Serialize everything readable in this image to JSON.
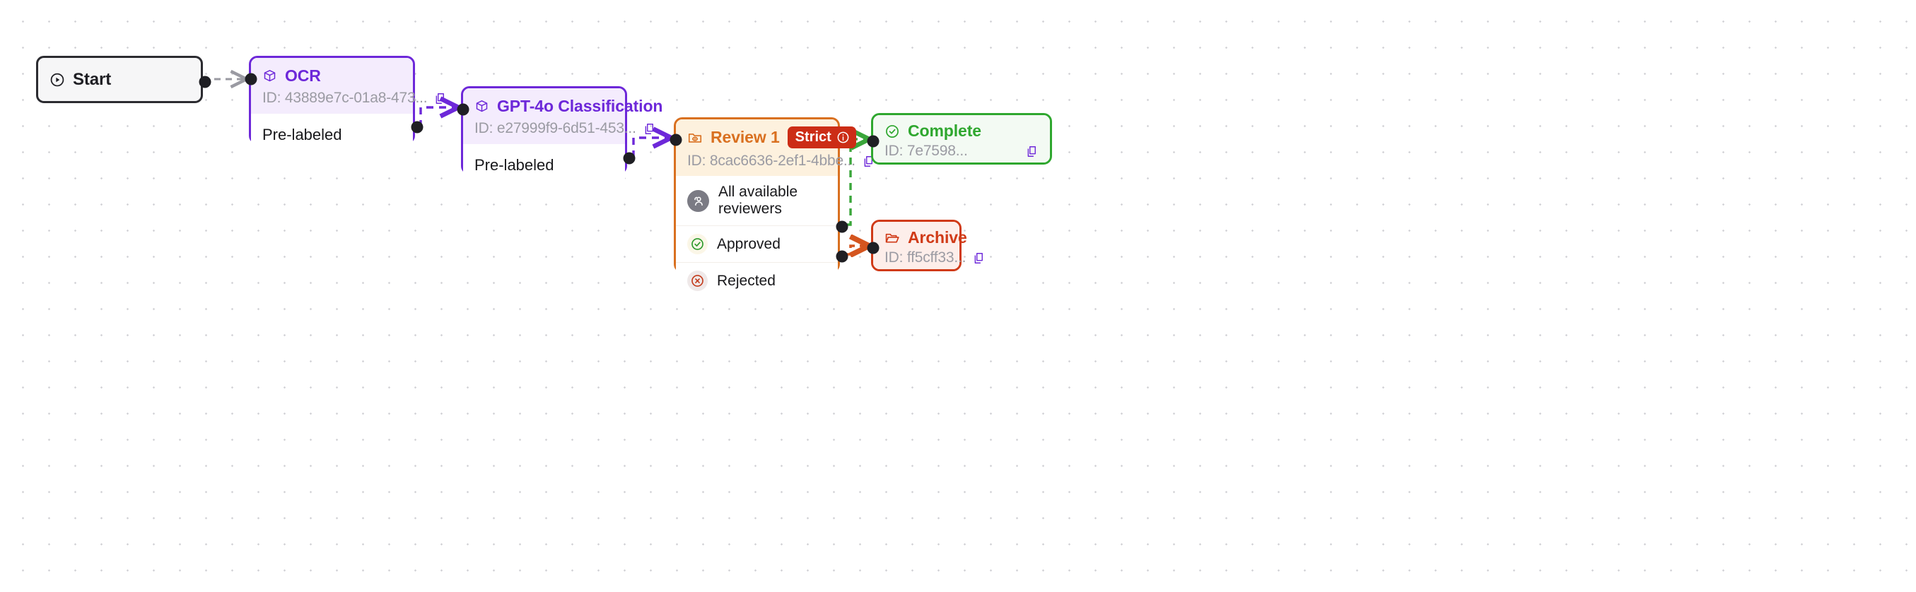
{
  "canvas": {
    "background_color": "#ffffff",
    "dot_grid_color": "#d4d4d8"
  },
  "nodes": [
    {
      "id": "start",
      "type": "start",
      "title": "Start",
      "icon": "play-circle-icon",
      "border_color": "#2b2b30",
      "background_color": "#f6f6f7"
    },
    {
      "id": "ocr",
      "type": "model",
      "title": "OCR",
      "icon": "cube-icon",
      "id_label": "ID: 43889e7c-01a8-473...",
      "copy_icon": "copy-icon",
      "body_label": "Pre-labeled",
      "border_color": "#6d28d9",
      "header_color": "#f4ecfd",
      "title_color": "#6d28d9"
    },
    {
      "id": "gpt",
      "type": "model",
      "title": "GPT-4o Classification",
      "icon": "cube-icon",
      "id_label": "ID: e27999f9-6d51-453...",
      "copy_icon": "copy-icon",
      "body_label": "Pre-labeled",
      "border_color": "#6d28d9",
      "header_color": "#f4ecfd",
      "title_color": "#6d28d9"
    },
    {
      "id": "review",
      "type": "review",
      "title": "Review 1",
      "icon": "folder-eye-icon",
      "badge_label": "Strict",
      "badge_icon": "info-icon",
      "badge_color": "#cc2d16",
      "id_label": "ID: 8cac6636-2ef1-4bbe...",
      "copy_icon": "copy-icon",
      "border_color": "#d97020",
      "header_color": "#fdf1de",
      "title_color": "#d97020",
      "rows": [
        {
          "label": "All available reviewers",
          "icon": "reviewers-avatar-icon",
          "kind": "assignee"
        },
        {
          "label": "Approved",
          "icon": "check-circle-icon",
          "kind": "approved"
        },
        {
          "label": "Rejected",
          "icon": "x-circle-icon",
          "kind": "rejected"
        }
      ]
    },
    {
      "id": "complete",
      "type": "terminal",
      "title": "Complete",
      "icon": "check-circle-icon",
      "id_label": "ID: 7e7598...",
      "copy_icon": "copy-icon",
      "border_color": "#2fa72f",
      "header_color": "#f3faf3",
      "title_color": "#2fa72f"
    },
    {
      "id": "archive",
      "type": "terminal",
      "title": "Archive",
      "icon": "open-folder-icon",
      "id_label": "ID: ff5cff33...",
      "copy_icon": "copy-icon",
      "border_color": "#d03a17",
      "header_color": "#fdeeea",
      "title_color": "#d03a17"
    }
  ],
  "edges": [
    {
      "id": "start-to-ocr",
      "from": "start",
      "to": "ocr",
      "color": "#9a9aa2",
      "style": "dashed"
    },
    {
      "id": "ocr-to-gpt",
      "from": "ocr",
      "to": "gpt",
      "color": "#6d28d9",
      "style": "dashed"
    },
    {
      "id": "gpt-to-review",
      "from": "gpt",
      "to": "review",
      "color": "#6d28d9",
      "style": "dashed"
    },
    {
      "id": "approved-to-complete",
      "from": "review.approved",
      "to": "complete",
      "color": "#3aa63a",
      "style": "dashed"
    },
    {
      "id": "rejected-to-archive",
      "from": "review.rejected",
      "to": "archive",
      "color": "#d4551f",
      "style": "dashed"
    }
  ]
}
